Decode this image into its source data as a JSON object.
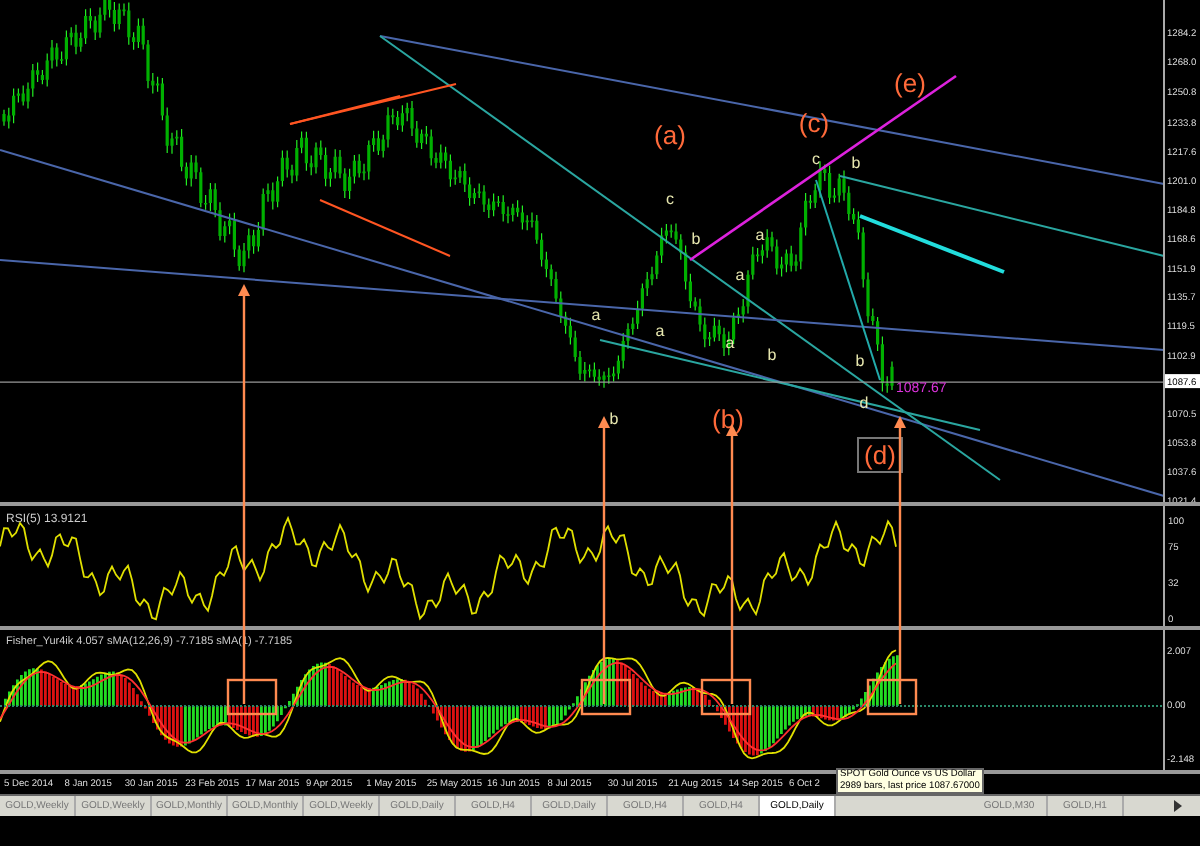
{
  "main_chart": {
    "price_ticks": [
      "1284.2",
      "1268.0",
      "1250.8",
      "1233.8",
      "1217.6",
      "1201.0",
      "1184.8",
      "1168.6",
      "1151.9",
      "1135.7",
      "1119.5",
      "1102.9",
      "1070.5",
      "1053.8",
      "1037.6",
      "1021.4"
    ],
    "current_price": "1087.6",
    "price_tag": "1087.67",
    "wave_labels": [
      {
        "text": "(a)",
        "kind": "major"
      },
      {
        "text": "(b)",
        "kind": "major"
      },
      {
        "text": "(c)",
        "kind": "major"
      },
      {
        "text": "(d)",
        "kind": "boxed"
      },
      {
        "text": "(e)",
        "kind": "major"
      },
      {
        "text": "a",
        "kind": "minor"
      },
      {
        "text": "b",
        "kind": "minor"
      },
      {
        "text": "c",
        "kind": "minor"
      },
      {
        "text": "b",
        "kind": "minor"
      },
      {
        "text": "a",
        "kind": "minor"
      },
      {
        "text": "a",
        "kind": "minor"
      },
      {
        "text": "b",
        "kind": "minor"
      },
      {
        "text": "a",
        "kind": "minor"
      },
      {
        "text": "c",
        "kind": "minor"
      },
      {
        "text": "b",
        "kind": "minor"
      },
      {
        "text": "a",
        "kind": "minor"
      },
      {
        "text": "b",
        "kind": "minor"
      },
      {
        "text": "d",
        "kind": "minor"
      }
    ]
  },
  "rsi_pane": {
    "label": "RSI(5) 13.9121",
    "ticks": [
      "100",
      "75",
      "32",
      "0"
    ]
  },
  "fisher_pane": {
    "label": "Fisher_Yur4ik 4.057  sMA(12,26,9) -7.7185  sMA(1) -7.7185",
    "ticks": [
      "2.007",
      "0.00",
      "-2.148"
    ]
  },
  "time_axis": [
    "5 Dec 2014",
    "8 Jan 2015",
    "30 Jan 2015",
    "23 Feb 2015",
    "17 Mar 2015",
    "9 Apr 2015",
    "1 May 2015",
    "25 May 2015",
    "16 Jun 2015",
    "8 Jul 2015",
    "30 Jul 2015",
    "21 Aug 2015",
    "14 Sep 2015",
    "6 Oct 2"
  ],
  "tabs": [
    {
      "label": "GOLD,Weekly",
      "selected": false
    },
    {
      "label": "GOLD,Weekly",
      "selected": false
    },
    {
      "label": "GOLD,Monthly",
      "selected": false
    },
    {
      "label": "GOLD,Monthly",
      "selected": false
    },
    {
      "label": "GOLD,Weekly",
      "selected": false
    },
    {
      "label": "GOLD,Daily",
      "selected": false
    },
    {
      "label": "GOLD,H4",
      "selected": false
    },
    {
      "label": "GOLD,Daily",
      "selected": false
    },
    {
      "label": "GOLD,H4",
      "selected": false
    },
    {
      "label": "GOLD,H4",
      "selected": false
    },
    {
      "label": "GOLD,Daily",
      "selected": true
    },
    {
      "label": "GOLD,M30",
      "selected": false
    },
    {
      "label": "GOLD,H1",
      "selected": false
    }
  ],
  "tooltip": {
    "lines": [
      "SPOT Gold Ounce vs US Dollar",
      "2989 bars, last price 1087.67000"
    ]
  }
}
